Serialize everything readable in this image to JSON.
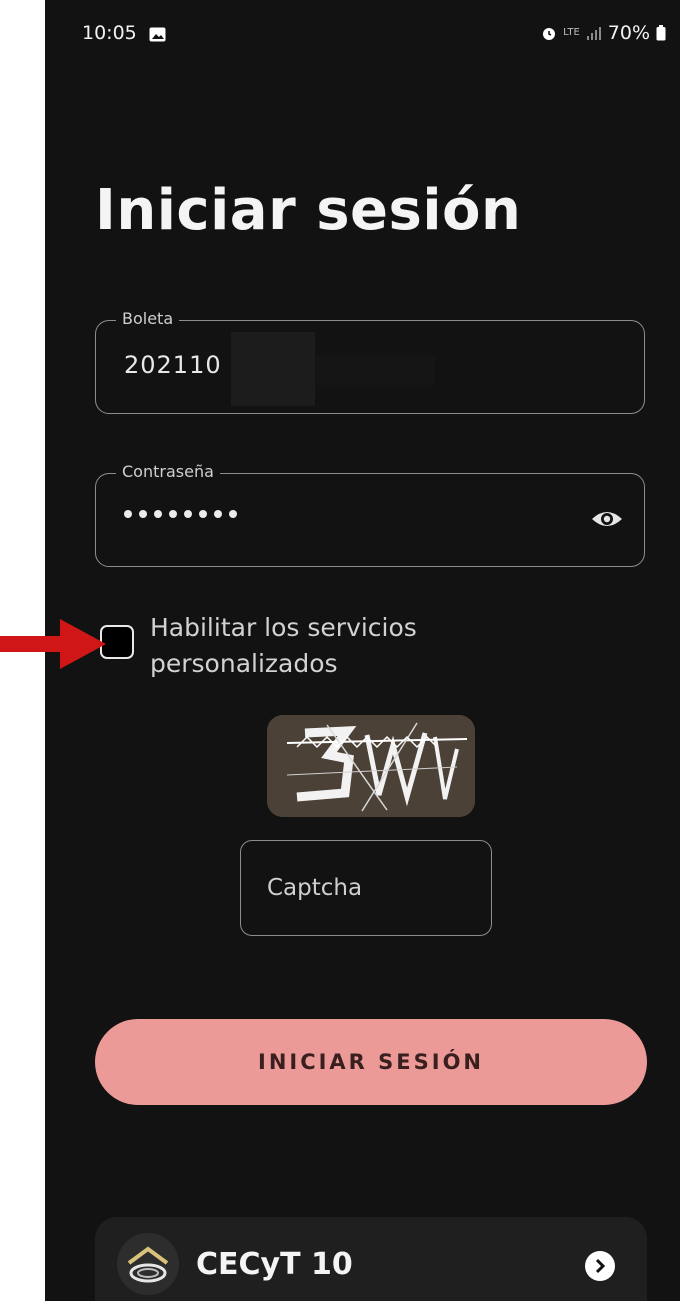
{
  "status_bar": {
    "time": "10:05",
    "network": "LTE",
    "battery": "70%"
  },
  "login": {
    "title": "Iniciar sesión",
    "boleta_label": "Boleta",
    "boleta_value": "202110",
    "password_label": "Contraseña",
    "remember_label": "Habilitar los servicios personalizados",
    "remember_checked": false,
    "captcha_placeholder": "Captcha",
    "submit_label": "INICIAR SESIÓN"
  },
  "school": {
    "name": "CECyT 10"
  },
  "colors": {
    "background": "#121212",
    "accent": "#ec9a98",
    "annotation_arrow": "#d01616"
  }
}
